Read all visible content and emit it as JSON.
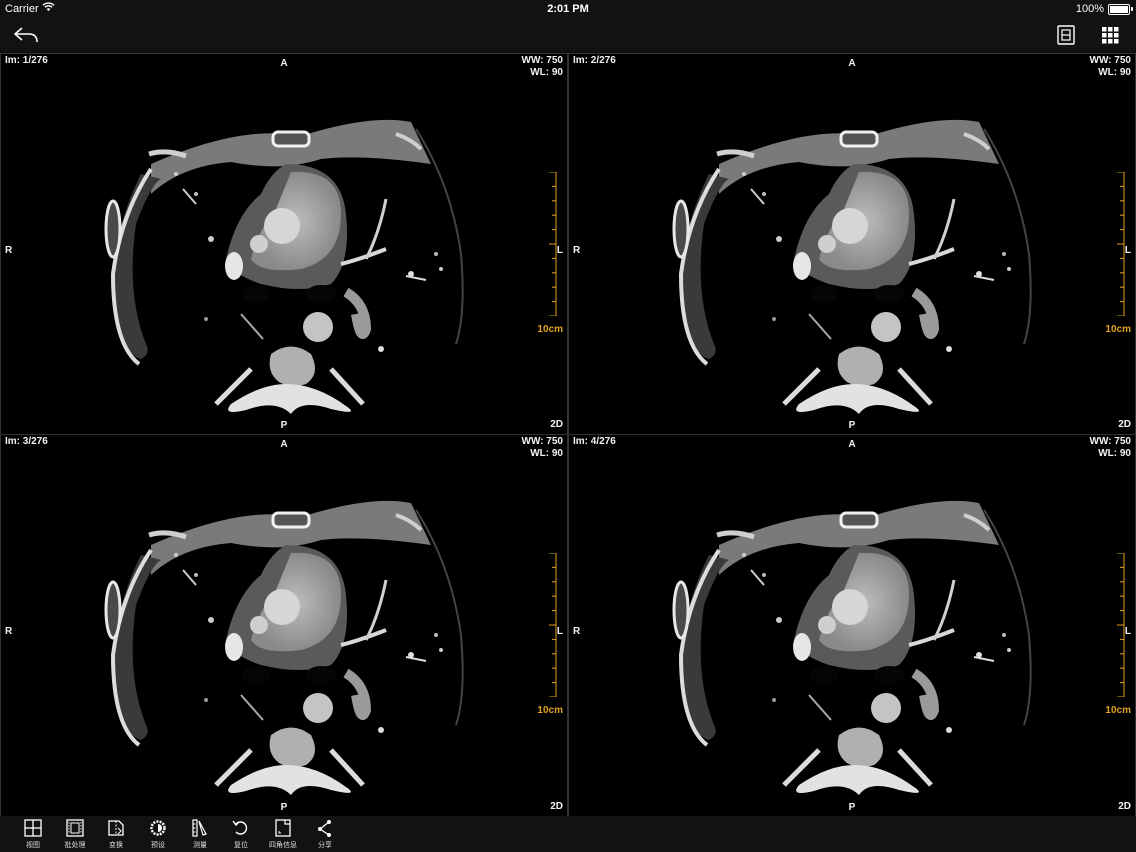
{
  "status_bar": {
    "carrier": "Carrier",
    "time": "2:01 PM",
    "battery": "100%"
  },
  "viewports": [
    {
      "image": "Im: 1/276",
      "ww": "WW: 750",
      "wl": "WL: 90",
      "top": "A",
      "bottom": "P",
      "left": "R",
      "right": "L",
      "mode": "2D",
      "scale": "10cm"
    },
    {
      "image": "Im: 2/276",
      "ww": "WW: 750",
      "wl": "WL: 90",
      "top": "A",
      "bottom": "P",
      "left": "R",
      "right": "L",
      "mode": "2D",
      "scale": "10cm"
    },
    {
      "image": "Im: 3/276",
      "ww": "WW: 750",
      "wl": "WL: 90",
      "top": "A",
      "bottom": "P",
      "left": "R",
      "right": "L",
      "mode": "2D",
      "scale": "10cm"
    },
    {
      "image": "Im: 4/276",
      "ww": "WW: 750",
      "wl": "WL: 90",
      "top": "A",
      "bottom": "P",
      "left": "R",
      "right": "L",
      "mode": "2D",
      "scale": "10cm"
    }
  ],
  "toolbar": [
    {
      "label": "视图",
      "icon": "grid-view-icon"
    },
    {
      "label": "批处理",
      "icon": "film-icon"
    },
    {
      "label": "变换",
      "icon": "transform-icon"
    },
    {
      "label": "预设",
      "icon": "preset-icon"
    },
    {
      "label": "测量",
      "icon": "measure-icon"
    },
    {
      "label": "复位",
      "icon": "reset-icon"
    },
    {
      "label": "四角信息",
      "icon": "corner-info-icon"
    },
    {
      "label": "分享",
      "icon": "share-icon"
    }
  ],
  "colors": {
    "overlay_text": "#f2f2f2",
    "scale_accent": "#e1a21f",
    "bar_bg": "#121212"
  }
}
